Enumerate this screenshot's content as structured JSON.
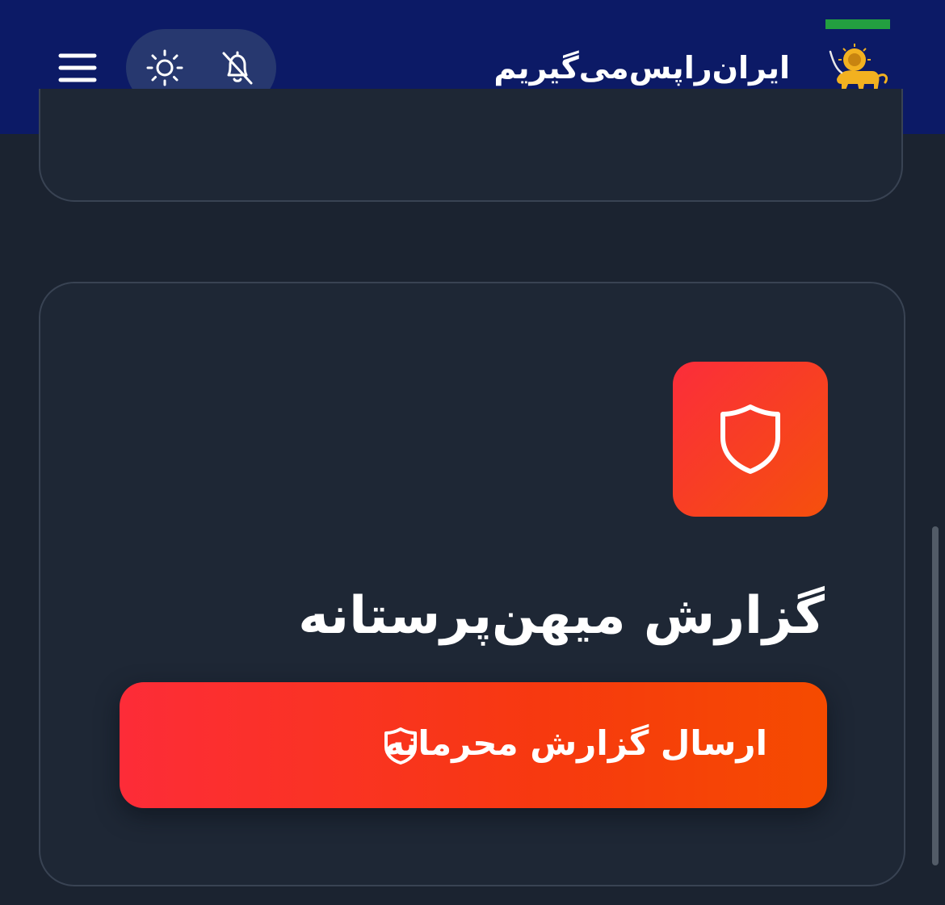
{
  "header": {
    "brand_title": "ایران‌را‌پس‌می‌گیریم",
    "menu_icon": "hamburger-menu-icon",
    "theme_icon": "sun-icon",
    "notifications_icon": "bell-off-icon",
    "logo": "lion-and-sun-flag-logo"
  },
  "card": {
    "icon": "shield-icon",
    "title": "گزارش میهن‌پرستانه",
    "button_label": "ارسال گزارش محرمانه",
    "button_icon": "shield-icon"
  },
  "colors": {
    "header_bg": "#0c1a66",
    "page_bg": "#1b2330",
    "card_bg": "#1e2735",
    "accent_start": "#fb2d3b",
    "accent_end": "#f54b00",
    "flag_green": "#239f40",
    "flag_red": "#da0000"
  }
}
